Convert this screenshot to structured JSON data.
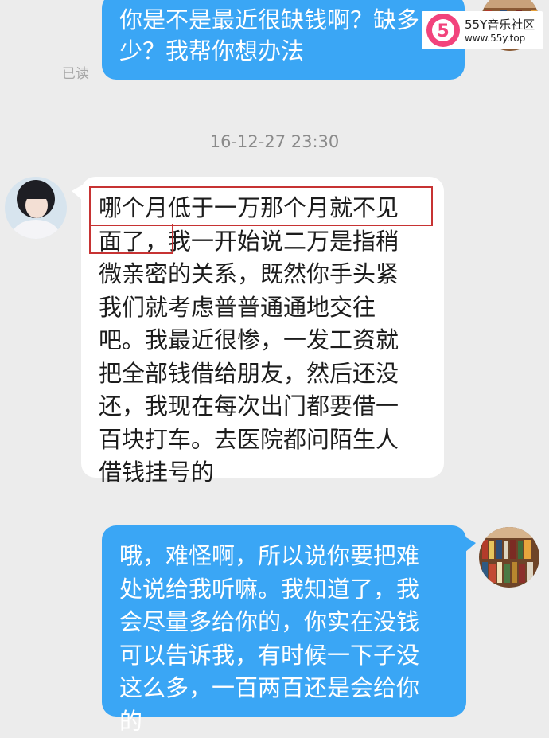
{
  "conversation": {
    "messages": [
      {
        "direction": "outgoing",
        "lines": [
          "你是不是最近很缺钱啊？缺多",
          "少？我帮你想办法"
        ],
        "read_status": "已读"
      },
      {
        "direction": "incoming",
        "timestamp": "16-12-27 23:30",
        "lines": [
          "哪个月低于一万那个月就不见",
          "面了，我一开始说二万是指稍",
          "微亲密的关系，既然你手头紧",
          "我们就考虑普普通通地交往",
          "吧。我最近很惨，一发工资就",
          "把全部钱借给朋友，然后还没",
          "还，我现在每次出门都要借一",
          "百块打车。去医院都问陌生人",
          "借钱挂号的"
        ]
      },
      {
        "direction": "outgoing",
        "lines": [
          "哦，难怪啊，所以说你要把难",
          "处说给我听嘛。我知道了，我",
          "会尽量多给你的，你实在没钱",
          "可以告诉我，有时候一下子没",
          "这么多，一百两百还是会给你",
          "的"
        ]
      }
    ]
  },
  "watermark": {
    "logo_text": "5",
    "title": "55Y音乐社区",
    "url": "www.55y.top"
  },
  "colors": {
    "background": "#ececec",
    "outgoing_bubble": "#3aa6f5",
    "incoming_bubble": "#ffffff",
    "highlight_box": "#c73333",
    "logo_pink": "#f2437c"
  }
}
